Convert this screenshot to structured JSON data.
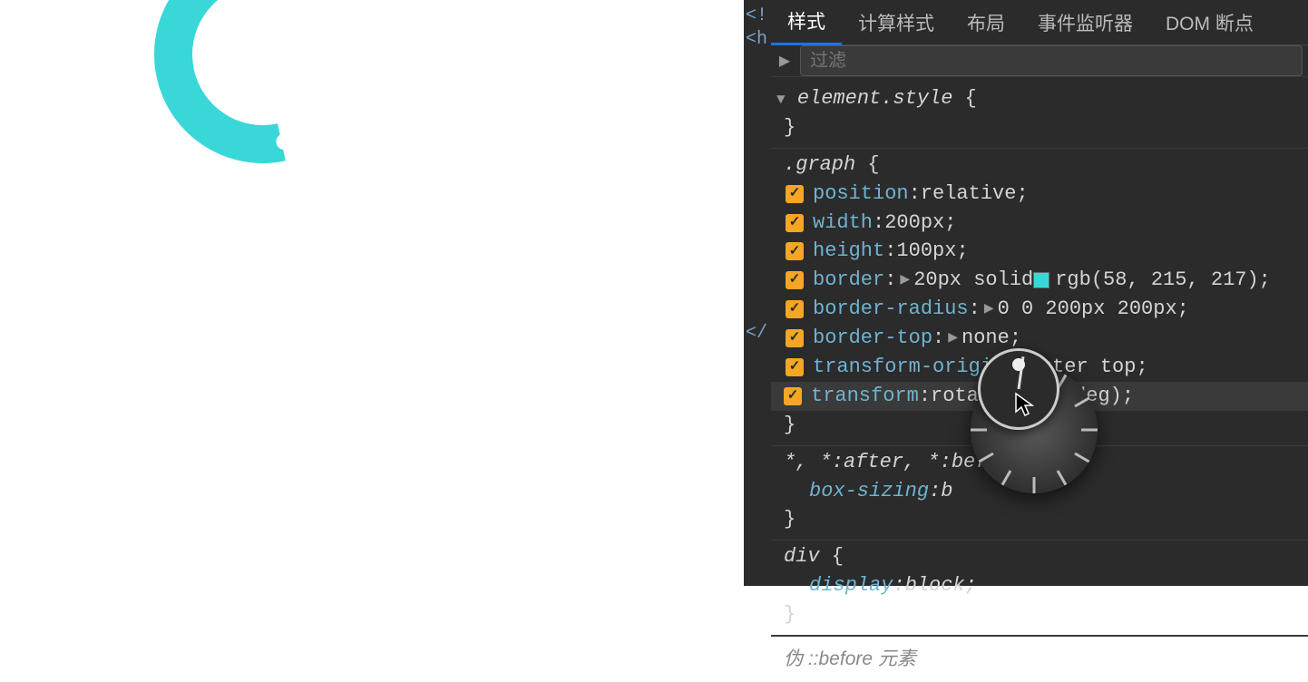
{
  "dom_gutter": {
    "l1": "<!",
    "l2": "<h",
    "close": "</"
  },
  "tabs": {
    "styles": "样式",
    "computed": "计算样式",
    "layout": "布局",
    "listeners": "事件监听器",
    "dom_breakpoints": "DOM 断点"
  },
  "filter": {
    "placeholder": "过滤",
    "toggle": "▶"
  },
  "rules": {
    "element_style": {
      "selector": "element.style",
      "open": " {",
      "close": "}"
    },
    "graph": {
      "selector": ".graph",
      "open": " {",
      "close": "}",
      "decls": {
        "position": {
          "prop": "position",
          "val": "relative",
          "sep": ": ",
          "end": ";"
        },
        "width": {
          "prop": "width",
          "val": "200px",
          "sep": ": ",
          "end": ";"
        },
        "height": {
          "prop": "height",
          "val": "100px",
          "sep": ": ",
          "end": ";"
        },
        "border": {
          "prop": "border",
          "valA": "20px solid",
          "valColor": "rgb(58, 215, 217)",
          "sep": ": ",
          "end": ";",
          "tri": "▶"
        },
        "border_radius": {
          "prop": "border-radius",
          "val": "0 0 200px 200px",
          "sep": ": ",
          "end": ";",
          "tri": "▶"
        },
        "border_top": {
          "prop": "border-top",
          "val": "none",
          "sep": ": ",
          "end": ";",
          "tri": "▶"
        },
        "transform_origin": {
          "prop": "transform-origin",
          "val": "center top",
          "sep": ": ",
          "end": ";"
        },
        "transform": {
          "prop": "transform",
          "valA": "rotate(",
          "valDeg": "348deg",
          "valB": ")",
          "sep": ": ",
          "end": ";"
        }
      }
    },
    "universal": {
      "selector": "*, *:after, *:bef",
      "open": "",
      "close": "}",
      "decl": {
        "prop": "box-sizing",
        "val": "b",
        "sep": ": "
      }
    },
    "div": {
      "selector": "div",
      "open": " {",
      "close": "}",
      "decl": {
        "prop": "display",
        "val": "block",
        "sep": ": ",
        "end": ";"
      }
    }
  },
  "pseudo_footer": "伪 ::before 元素",
  "drag_dots": "⋯",
  "colors": {
    "accent": "rgb(58, 215, 217)"
  },
  "angle_widget": {
    "value_deg": 348
  }
}
